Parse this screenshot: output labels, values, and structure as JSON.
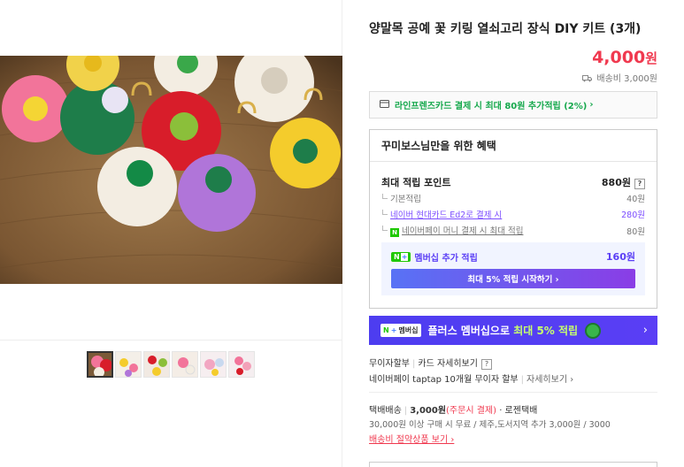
{
  "product": {
    "title": "양말목 공예 꽃 키링 열쇠고리 장식 DIY 키트 (3개)",
    "price_number": "4,000",
    "price_unit": "원",
    "shipping_label": "배송비 3,000원"
  },
  "card_promo": {
    "text": "라인프렌즈카드 결제 시 최대 80원 추가적립 (2%)",
    "chevron": "›"
  },
  "benefit": {
    "heading": "꾸미보스님만을 위한 혜택",
    "max_points_label": "최대 적립 포인트",
    "max_points_value": "880원",
    "help": "?",
    "rows": [
      {
        "label": "기본적립",
        "value": "40원"
      },
      {
        "label": "네이버 현대카드 Ed2로 결제 시",
        "value": "280원"
      },
      {
        "label": "네이버페이 머니 결제 시 최대 적립",
        "value": "80원"
      }
    ],
    "member_label": "멤버십 추가 적립",
    "member_value": "160원",
    "start_button": "최대 5% 적립 시작하기 ›",
    "nplus_n": "N",
    "nplus_plus": "+"
  },
  "plus_banner": {
    "tag_n": "N",
    "tag_plus": "+",
    "tag_text": "멤버십",
    "text_before": "플러스 멤버십으로 ",
    "text_highlight": "최대 5% 적립",
    "chevron": "›"
  },
  "payment": {
    "installment": "무이자할부",
    "card_detail": "카드 자세히보기",
    "help": "?",
    "naverpay_installment": "네이버페이 taptap 10개월 무이자 할부",
    "detail_link": "자세히보기 ›"
  },
  "delivery": {
    "method": "택배배송",
    "price": "3,000원",
    "price_note": "(주문시 결제)",
    "carrier": "· 로젠택배",
    "free_condition": "30,000원 이상 구매 시 무료 / 제주,도서지역 추가 3,000원 / 3000",
    "save_link": "배송비 절약상품 보기 ›"
  },
  "icons": {
    "truck": "truck-icon",
    "card": "credit-card-icon",
    "naverpay": "naverpay-icon"
  },
  "colors": {
    "price": "#f0394f",
    "promo_green": "#15a84c",
    "membership_purple": "#5a3ef5"
  }
}
